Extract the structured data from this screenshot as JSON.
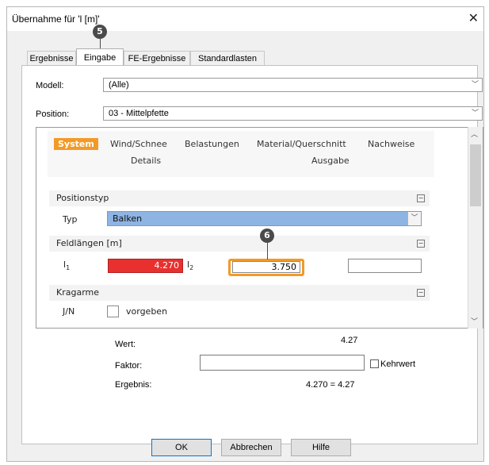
{
  "window": {
    "title": "Übernahme für 'l [m]'"
  },
  "badges": {
    "five": "5",
    "six": "6"
  },
  "tabs": [
    "Ergebnisse",
    "Eingabe",
    "FE-Ergebnisse",
    "Standardlasten"
  ],
  "modell": {
    "label": "Modell:",
    "value": "(Alle)"
  },
  "position": {
    "label": "Position:",
    "value": "03 - Mittelpfette"
  },
  "menu": {
    "items": [
      "System",
      "Wind/Schnee",
      "Belastungen",
      "Material/Querschnitt",
      "Nachweise",
      "Details",
      "Ausgabe"
    ]
  },
  "positionstyp": {
    "section": "Positionstyp",
    "typ_label": "Typ",
    "typ_value": "Balken"
  },
  "feldlaengen": {
    "section": "Feldlängen [m]",
    "l1_label": "l",
    "l1_sub": "1",
    "l1_value": "4.270",
    "l2_label": "l",
    "l2_sub": "2",
    "l2_value": "3.750"
  },
  "kragarme": {
    "section": "Kragarme",
    "jn_label": "J/N",
    "vorgeben": "vorgeben"
  },
  "result": {
    "wert_label": "Wert:",
    "wert_value": "4.27",
    "faktor_label": "Faktor:",
    "faktor_value": "",
    "kehrwert": "Kehrwert",
    "ergebnis_label": "Ergebnis:",
    "ergebnis_value": "4.270 = 4.27"
  },
  "buttons": {
    "ok": "OK",
    "abbrechen": "Abbrechen",
    "hilfe": "Hilfe"
  },
  "colors": {
    "accent": "#f39a26",
    "red_field": "#e8312f",
    "typ_blue": "#8db4e2",
    "badge": "#4a4a4a"
  },
  "icons": {
    "close": "close-icon",
    "collapse": "minus-box-icon",
    "dropdown": "chevron-down-icon"
  }
}
